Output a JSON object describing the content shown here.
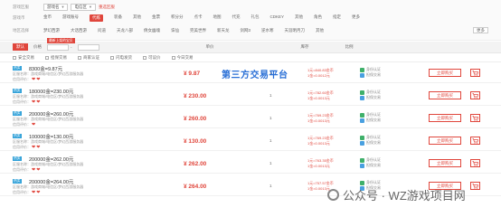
{
  "filters": {
    "row1": {
      "label": "游戏区服",
      "chips": [
        "游戏名",
        "电信区"
      ],
      "link": "重选区服"
    },
    "row2": {
      "label": "游戏币",
      "options": [
        "金币",
        "游戏账号",
        "代练",
        "装备",
        "其他",
        "金票",
        "积分分",
        "点卡",
        "地图",
        "代充",
        "礼包",
        "CDKEY",
        "其他",
        "角色",
        "指定",
        "更多"
      ],
      "active_index": 2
    },
    "row3": {
      "label": "地区选择",
      "options": [
        "梦幻西游",
        "大话西游",
        "问道",
        "天龙八部",
        "倩女幽魂",
        "诛仙",
        "完美世界",
        "新天龙",
        "剑网3",
        "逆水寒",
        "天涯明月刀",
        "其他"
      ],
      "more": "更多"
    }
  },
  "sortbar": {
    "items": [
      "默认",
      "价格",
      "单价",
      "库存",
      "比例"
    ],
    "active_index": 0,
    "tip": "最新上架的宝贝"
  },
  "checks": [
    "安全交易",
    "担保交易",
    "商家认证",
    "闪电发货",
    "可议价",
    "今日交易"
  ],
  "overlay": "第三方交易平台",
  "watermark": "公众号 · WZ游戏项目网",
  "colors": {
    "accent": "#e0463c",
    "tag": "#2fa0d8",
    "overlay": "#2a6fd6"
  },
  "rows": [
    {
      "tag": "热卖",
      "title": "8300金=9.87元",
      "area": "区服名称：游戏商城/电信区/梦幻西游服务器",
      "rating_label": "信用评价：",
      "hearts": 2,
      "price": "¥ 9.87",
      "stock": "1",
      "ratio1": "1元=840.83金币",
      "ratio2": "1金=0.0012元",
      "sec1": "身份认证",
      "sec2": "担保交易",
      "buy": "立即购买"
    },
    {
      "tag": "热卖",
      "title": "180000金=230.00元",
      "area": "区服名称：游戏商城/电信区/梦幻西游服务器",
      "rating_label": "信用评价：",
      "hearts": 2,
      "price": "¥ 230.00",
      "stock": "1",
      "ratio1": "1元=782.60金币",
      "ratio2": "1金=0.0013元",
      "sec1": "身份认证",
      "sec2": "担保交易",
      "buy": "立即购买"
    },
    {
      "tag": "热卖",
      "title": "200000金=260.00元",
      "area": "区服名称：游戏商城/电信区/梦幻西游服务器",
      "rating_label": "信用评价：",
      "hearts": 1,
      "price": "¥ 260.00",
      "stock": "1",
      "ratio1": "1元=769.23金币",
      "ratio2": "1金=0.0013元",
      "sec1": "身份认证",
      "sec2": "担保交易",
      "buy": "立即购买"
    },
    {
      "tag": "热卖",
      "title": "100000金=130.00元",
      "area": "区服名称：游戏商城/电信区/梦幻西游服务器",
      "rating_label": "信用评价：",
      "hearts": 2,
      "price": "¥ 130.00",
      "stock": "1",
      "ratio1": "1元=769.23金币",
      "ratio2": "1金=0.0013元",
      "sec1": "身份认证",
      "sec2": "担保交易",
      "buy": "立即购买"
    },
    {
      "tag": "热卖",
      "title": "200000金=262.00元",
      "area": "区服名称：游戏商城/电信区/梦幻西游服务器",
      "rating_label": "信用评价：",
      "hearts": 2,
      "price": "¥ 262.00",
      "stock": "1",
      "ratio1": "1元=763.35金币",
      "ratio2": "1金=0.0013元",
      "sec1": "身份认证",
      "sec2": "担保交易",
      "buy": "立即购买"
    },
    {
      "tag": "热卖",
      "title": "200000金=264.00元",
      "area": "区服名称：游戏商城/电信区/梦幻西游服务器",
      "rating_label": "信用评价：",
      "hearts": 2,
      "price": "¥ 264.00",
      "stock": "1",
      "ratio1": "1元=757.57金币",
      "ratio2": "1金=0.0013元",
      "sec1": "身份认证",
      "sec2": "担保交易",
      "buy": "立即购买"
    }
  ]
}
